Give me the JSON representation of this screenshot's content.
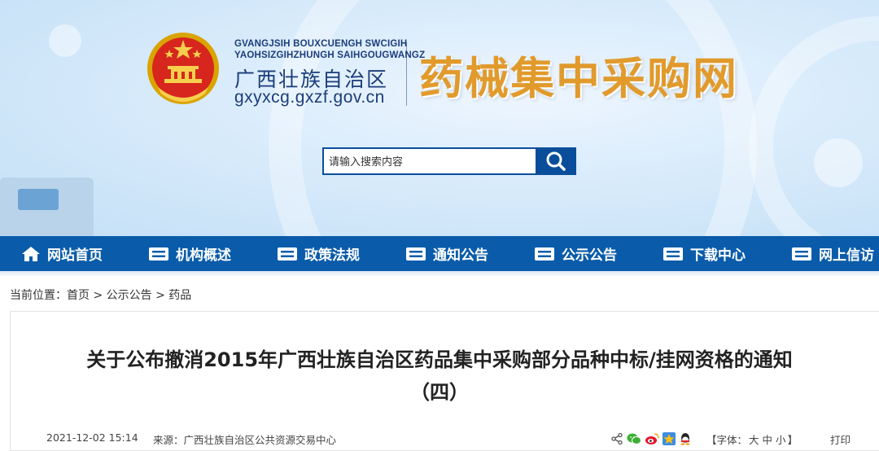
{
  "header": {
    "en_line1": "GVANGJSIH BOUXCUENGH SWCIGIH",
    "en_line2": "YAOHSIZGIHZHUNGH SAIHGOUGWANGZ",
    "region_name": "广西壮族自治区",
    "url": "gxyxcg.gxzf.gov.cn",
    "site_title": "药械集中采购网",
    "title_color": "#e19a2c",
    "brand_color": "#1b3d7a"
  },
  "search": {
    "placeholder": "请输入搜索内容",
    "icon": "search-icon"
  },
  "nav": {
    "color": "#0a5caa",
    "items": [
      {
        "label": "网站首页",
        "icon": "home-icon"
      },
      {
        "label": "机构概述",
        "icon": "menu-icon"
      },
      {
        "label": "政策法规",
        "icon": "menu-icon"
      },
      {
        "label": "通知公告",
        "icon": "menu-icon"
      },
      {
        "label": "公示公告",
        "icon": "menu-icon"
      },
      {
        "label": "下载中心",
        "icon": "menu-icon"
      },
      {
        "label": "网上信访",
        "icon": "menu-icon"
      }
    ]
  },
  "breadcrumb": {
    "prefix": "当前位置：",
    "items": [
      "首页",
      "公示公告",
      "药品"
    ],
    "separator": ">"
  },
  "article": {
    "title_line1": "关于公布撤消2015年广西壮族自治区药品集中采购部分品种中标/挂网资格的通知",
    "title_line2": "（四）",
    "date": "2021-12-02 15:14",
    "source": "来源：广西壮族自治区公共资源交易中心",
    "font_label_open": "【字体：",
    "font_sizes": [
      "大",
      "中",
      "小"
    ],
    "font_label_close": "】",
    "print": "打印",
    "share_icons": [
      "share-icon",
      "wechat-icon",
      "weibo-icon",
      "qzone-icon",
      "qq-icon"
    ]
  }
}
